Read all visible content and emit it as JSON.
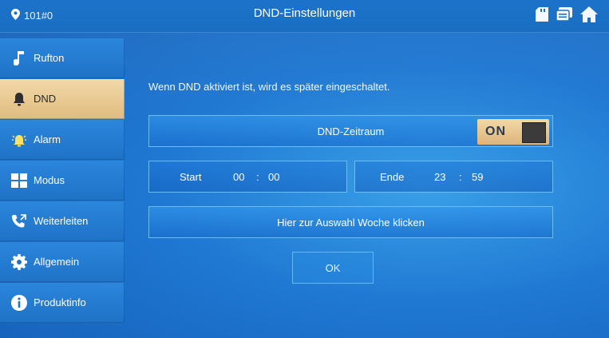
{
  "header": {
    "location": "101#0",
    "title": "DND-Einstellungen",
    "icons": [
      "sd-card-icon",
      "message-icon",
      "home-icon"
    ]
  },
  "sidebar": {
    "items": [
      {
        "label": "Rufton",
        "icon": "music-note-icon"
      },
      {
        "label": "DND",
        "icon": "bell-mute-icon",
        "active": true
      },
      {
        "label": "Alarm",
        "icon": "alarm-icon"
      },
      {
        "label": "Modus",
        "icon": "grid-icon"
      },
      {
        "label": "Weiterleiten",
        "icon": "call-forward-icon"
      },
      {
        "label": "Allgemein",
        "icon": "gear-icon"
      },
      {
        "label": "Produktinfo",
        "icon": "info-icon"
      }
    ]
  },
  "main": {
    "notice": "Wenn DND aktiviert ist, wird es später eingeschaltet.",
    "dnd_period_label": "DND-Zeitraum",
    "toggle_state": "ON",
    "start": {
      "label": "Start",
      "hour": "00",
      "sep": ":",
      "minute": "00"
    },
    "end": {
      "label": "Ende",
      "hour": "23",
      "sep": ":",
      "minute": "59"
    },
    "week_button": "Hier zur Auswahl Woche klicken",
    "ok_button": "OK"
  },
  "colors": {
    "background": "#1f78d2",
    "active_item": "#e9c990",
    "toggle_knob": "#3b3b3b"
  }
}
